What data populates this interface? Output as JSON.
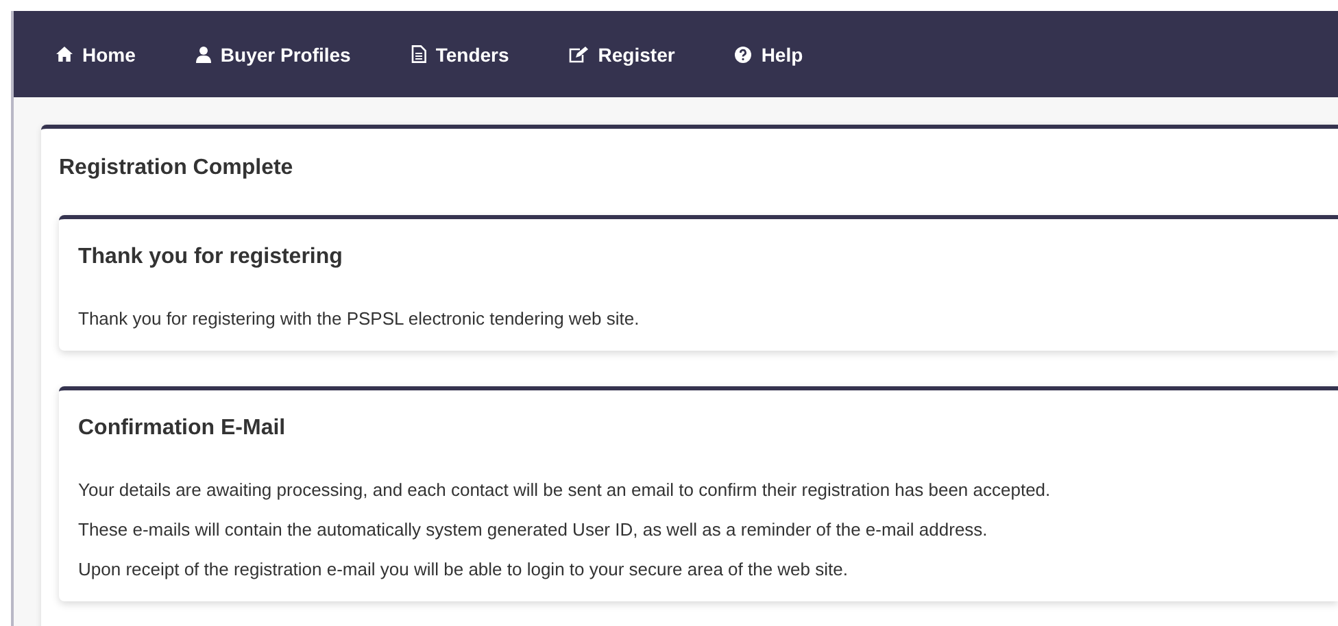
{
  "nav": {
    "items": [
      {
        "label": "Home",
        "kind": "home"
      },
      {
        "label": "Buyer Profiles",
        "kind": "user"
      },
      {
        "label": "Tenders",
        "kind": "document"
      },
      {
        "label": "Register",
        "kind": "edit"
      },
      {
        "label": "Help",
        "kind": "help"
      }
    ]
  },
  "panel": {
    "title": "Registration Complete",
    "cards": [
      {
        "title": "Thank you for registering",
        "paragraphs": [
          "Thank you for registering with the PSPSL electronic tendering web site."
        ]
      },
      {
        "title": "Confirmation E-Mail",
        "paragraphs": [
          "Your details are awaiting processing, and each contact will be sent an email to confirm their registration has been accepted.",
          "These e-mails will contain the automatically system generated User ID, as well as a reminder of the e-mail address.",
          "Upon receipt of the registration e-mail you will be able to login to your secure area of the web site."
        ]
      }
    ]
  }
}
